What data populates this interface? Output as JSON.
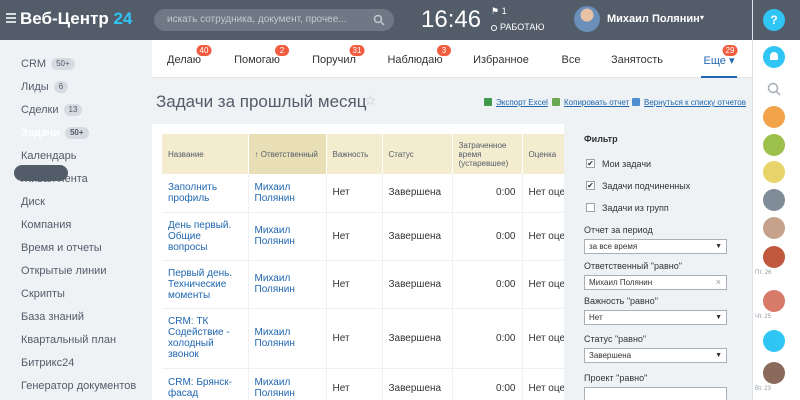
{
  "header": {
    "logo_text": "Веб-Центр",
    "logo_number": "24",
    "search_placeholder": "искать сотрудника, документ, прочее...",
    "time": "16:46",
    "flag_count": "1",
    "work_status": "РАБОТАЮ",
    "user_name": "Михаил Полянин"
  },
  "sidebar": {
    "items": [
      {
        "label": "CRM",
        "badge": "50+"
      },
      {
        "label": "Лиды",
        "badge": "6"
      },
      {
        "label": "Сделки",
        "badge": "13"
      },
      {
        "label": "Задачи",
        "badge": "50+"
      },
      {
        "label": "Календарь",
        "badge": ""
      },
      {
        "label": "Живая лента",
        "badge": ""
      },
      {
        "label": "Диск",
        "badge": ""
      },
      {
        "label": "Компания",
        "badge": ""
      },
      {
        "label": "Время и отчеты",
        "badge": ""
      },
      {
        "label": "Открытые линии",
        "badge": ""
      },
      {
        "label": "Скрипты",
        "badge": ""
      },
      {
        "label": "База знаний",
        "badge": ""
      },
      {
        "label": "Квартальный план",
        "badge": ""
      },
      {
        "label": "Битрикс24",
        "badge": ""
      },
      {
        "label": "Генератор документов",
        "badge": ""
      }
    ]
  },
  "tabs": [
    {
      "label": "Делаю",
      "badge": "40"
    },
    {
      "label": "Помогаю",
      "badge": "2"
    },
    {
      "label": "Поручил",
      "badge": "31"
    },
    {
      "label": "Наблюдаю",
      "badge": "3"
    },
    {
      "label": "Избранное",
      "badge": ""
    },
    {
      "label": "Все",
      "badge": ""
    },
    {
      "label": "Занятость",
      "badge": ""
    },
    {
      "label": "Еще ▾",
      "badge": "29"
    }
  ],
  "main": {
    "title": "Задачи за прошлый месяц",
    "actions": [
      "Экспорт Excel",
      "Копировать отчет",
      "Вернуться к списку отчетов"
    ]
  },
  "table": {
    "headers": [
      "Название",
      "↑ Ответственный",
      "Важность",
      "Статус",
      "Затраченное время (устаревшее)",
      "Оценка"
    ],
    "rows": [
      [
        "Заполнить профиль",
        "Михаил Полянин",
        "Нет",
        "Завершена",
        "0:00",
        "Нет оце"
      ],
      [
        "День первый. Общие вопросы",
        "Михаил Полянин",
        "Нет",
        "Завершена",
        "0:00",
        "Нет оце"
      ],
      [
        "Первый день. Технические моменты",
        "Михаил Полянин",
        "Нет",
        "Завершена",
        "0:00",
        "Нет оце"
      ],
      [
        "CRM: ТК Содействие - холодный звонок",
        "Михаил Полянин",
        "Нет",
        "Завершена",
        "0:00",
        "Нет оце"
      ],
      [
        "CRM: Брянск-фасад",
        "Михаил Полянин",
        "Нет",
        "Завершена",
        "0:00",
        "Нет оце"
      ]
    ]
  },
  "filter": {
    "title": "Фильтр",
    "checkboxes": [
      {
        "label": "Мои задачи",
        "checked": "✔"
      },
      {
        "label": "Задачи подчиненных",
        "checked": "✔"
      },
      {
        "label": "Задачи из групп",
        "checked": ""
      }
    ],
    "period_label": "Отчет за период",
    "period_value": "за все время",
    "responsible_label": "Ответственный \"равно\"",
    "responsible_value": "Михаил Полянин",
    "importance_label": "Важность \"равно\"",
    "importance_value": "Нет",
    "status_label": "Статус \"равно\"",
    "status_value": "Завершена",
    "project_label": "Проект \"равно\""
  },
  "right_panel": {
    "labels": [
      "Пт. 26",
      "Чт. 25",
      "Вт. 23"
    ]
  },
  "colors": {
    "topbar": "#535c69",
    "accent": "#2fc6f6",
    "badge_red": "#f25c40",
    "link": "#2067b0",
    "header_cell": "#f4ecce"
  }
}
